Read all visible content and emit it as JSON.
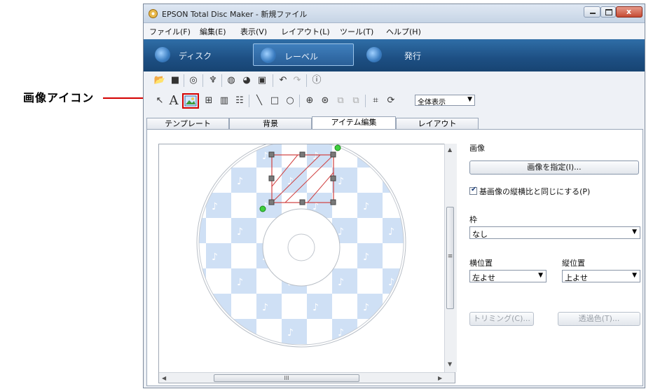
{
  "callout": {
    "label": "画像アイコン"
  },
  "window": {
    "title": "EPSON Total Disc Maker - 新規ファイル",
    "controls": {
      "minimize_icon": "minimize-icon",
      "maximize_icon": "maximize-icon",
      "close_glyph": "x"
    }
  },
  "menu": [
    "ファイル(F)",
    "編集(E)",
    "表示(V)",
    "レイアウト(L)",
    "ツール(T)",
    "ヘルプ(H)"
  ],
  "modes": [
    {
      "label": "ディスク",
      "active": false
    },
    {
      "label": "レーベル",
      "active": true
    },
    {
      "label": "発行",
      "active": false
    }
  ],
  "toolbar": {
    "zoom": "全体表示",
    "text_tool_glyph": "A",
    "icons_row1": [
      "open-folder-icon",
      "save-icon",
      "print-icon",
      "tools-icon",
      "disc-icon",
      "burn-icon",
      "export-icon",
      "undo-icon",
      "redo-icon",
      "help-icon"
    ],
    "icons_row2": [
      "arrow-icon",
      "text-icon",
      "image-icon",
      "grid-icon",
      "barcode-icon",
      "tree-icon",
      "line-icon",
      "rectangle-icon",
      "ellipse-icon",
      "align-icon",
      "order-icon",
      "front-icon",
      "back-icon",
      "crop-icon",
      "rotate-icon"
    ]
  },
  "tabs": [
    "テンプレート",
    "背景",
    "アイテム編集",
    "レイアウト"
  ],
  "active_tab": 2,
  "properties": {
    "image_heading": "画像",
    "specify_image_button": "画像を指定(I)...",
    "keep_aspect_label": "基画像の縦横比と同じにする(P)",
    "keep_aspect_checked": true,
    "frame_heading": "枠",
    "frame_value": "なし",
    "horizontal_heading": "横位置",
    "horizontal_value": "左よせ",
    "vertical_heading": "縦位置",
    "vertical_value": "上よせ",
    "trimming_button": "トリミング(C)...",
    "transparent_button": "透過色(T)..."
  },
  "colors": {
    "callout_red": "#d40000",
    "accent_blue": "#1d4f83",
    "tile_blue": "#cfe0f5"
  },
  "scroll": {
    "h_thumb_glyph": "III",
    "v_thumb_glyph": "≡"
  }
}
